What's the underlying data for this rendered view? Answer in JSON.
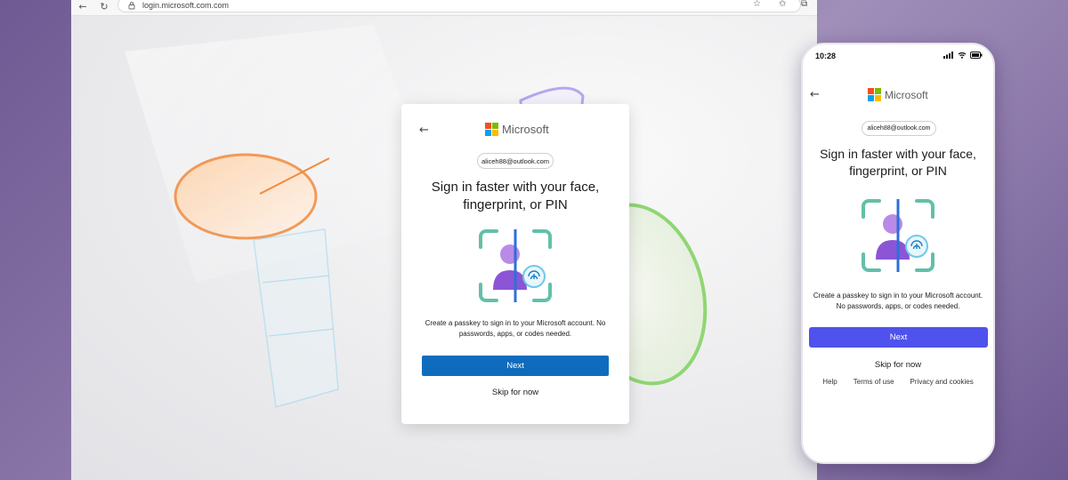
{
  "browser": {
    "url": "login.microsoft.com.com"
  },
  "brand": {
    "name": "Microsoft",
    "logo_colors": [
      "#f25022",
      "#7fba00",
      "#00a4ef",
      "#ffb900"
    ]
  },
  "desktop_card": {
    "email": "aliceh88@outlook.com",
    "headline": "Sign in faster with your face, fingerprint, or PIN",
    "description": "Create a passkey to sign in to your Microsoft account. No passwords, apps, or codes needed.",
    "next_label": "Next",
    "skip_label": "Skip for now",
    "accent": "#0f6cbd"
  },
  "phone": {
    "time": "10:28",
    "email": "aliceh88@outlook.com",
    "headline": "Sign in faster with your face, fingerprint, or PIN",
    "description": "Create a passkey to sign in to your Microsoft account. No passwords, apps, or codes needed.",
    "next_label": "Next",
    "skip_label": "Skip for now",
    "accent": "#4f52ec",
    "footer_links": [
      "Help",
      "Terms of use",
      "Privacy and cookies"
    ]
  }
}
